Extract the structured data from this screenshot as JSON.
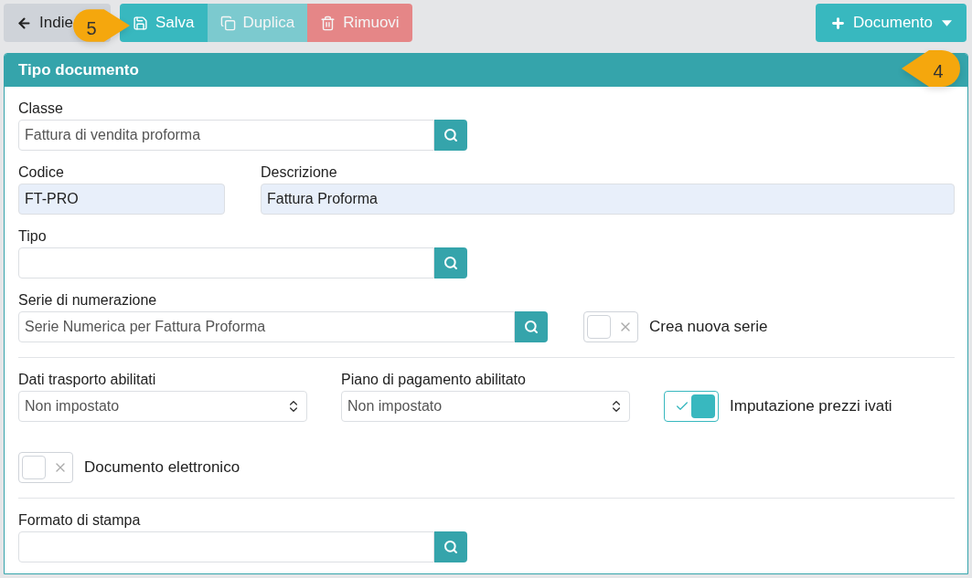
{
  "toolbar": {
    "buttons": [
      {
        "label": "Indie",
        "kind": "back",
        "disabled": false
      },
      {
        "label": "Salva",
        "kind": "save",
        "disabled": false
      },
      {
        "label": "Duplica",
        "kind": "copy",
        "disabled": true
      },
      {
        "label": "Rimuovi",
        "kind": "delete",
        "disabled": true
      }
    ],
    "menu_button": {
      "label": "Documento"
    }
  },
  "callouts": [
    {
      "label": "5",
      "kind": "save"
    },
    {
      "label": "4",
      "kind": "panel"
    }
  ],
  "panel": {
    "title": "Tipo documento",
    "rows": [
      {
        "kind": "lookup",
        "label": "Classe",
        "value": "Fattura di vendita proforma"
      },
      {
        "kind": "pair",
        "items": [
          {
            "label": "Codice",
            "value": "FT-PRO"
          },
          {
            "label": "Descrizione",
            "value": "Fattura Proforma"
          }
        ]
      },
      {
        "kind": "lookup",
        "label": "Tipo",
        "value": ""
      },
      {
        "kind": "lookup_toggle",
        "label": "Serie di numerazione",
        "value": "Serie Numerica per Fattura Proforma",
        "toggle": {
          "label": "Crea nuova serie",
          "on": false
        }
      },
      {
        "kind": "divider"
      },
      {
        "kind": "selects",
        "items": [
          {
            "label": "Dati trasporto abilitati",
            "value": "Non impostato"
          },
          {
            "label": "Piano di pagamento abilitato",
            "value": "Non impostato"
          }
        ],
        "toggle": {
          "label": "Imputazione prezzi ivati",
          "on": true
        }
      },
      {
        "kind": "toggle",
        "toggle": {
          "label": "Documento elettronico",
          "on": false
        }
      },
      {
        "kind": "divider"
      },
      {
        "kind": "lookup",
        "label": "Formato di stampa",
        "value": ""
      }
    ]
  }
}
